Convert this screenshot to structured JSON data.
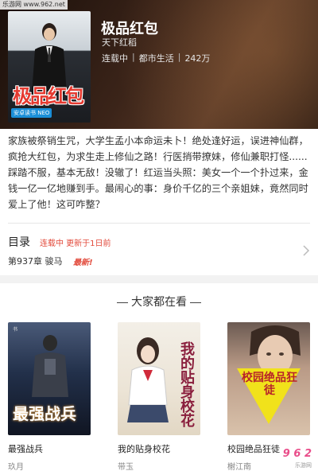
{
  "watermark": {
    "site": "乐游网 www.962.net",
    "logo": "9 6 2",
    "logo_sub": "乐游网"
  },
  "book": {
    "title": "极品红包",
    "author": "天下红稻",
    "status": "连载中",
    "category": "都市生活",
    "words": "242万",
    "cover_title": "极品红包",
    "cover_badge": "安卓读书 NEO"
  },
  "description": "家族被祭销生咒，大学生孟小本命运未卜！绝处逢好运，误进神仙群，疯抢大红包，为求生走上修仙之路！行医捎带撩妹，修仙兼职打怪......踩踏不服，基本无敌！没辙了！红运当头照：美女一个一个扑过来，金钱一亿一亿地赚到手。最闹心的事：身价千亿的三个亲姐妹，竟然同时爱上了他！这可咋整？",
  "toc": {
    "label": "目录",
    "status": "连载中  更新于1日前",
    "latest_chapter": "第937章  骏马",
    "latest_badge": "最新!"
  },
  "recommend": {
    "heading": "大家都在看",
    "items": [
      {
        "title": "最强战兵",
        "author": "玖月",
        "cover_text": "最强战兵"
      },
      {
        "title": "我的贴身校花",
        "author": "带玉",
        "cover_text": "我的贴身校花"
      },
      {
        "title": "校园绝品狂徒",
        "author": "榭江南",
        "cover_text": "校园绝品狂徒"
      }
    ]
  }
}
